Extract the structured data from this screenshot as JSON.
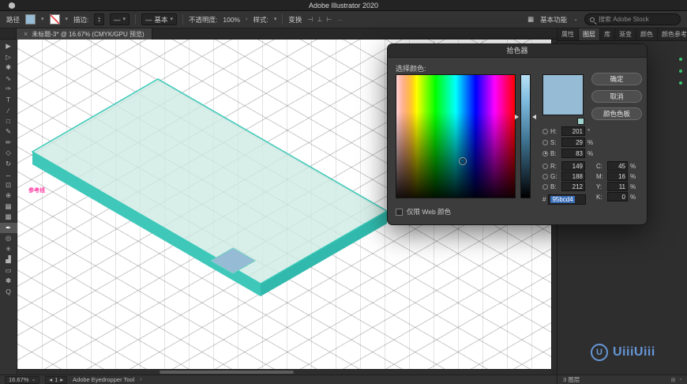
{
  "menubar": {
    "title": "Adobe Illustrator 2020"
  },
  "icons": {
    "caret_down": "▾",
    "caret_small": "⌄",
    "caret_up": "▴",
    "chevron": "›",
    "close": "×",
    "arrow_left": "◂",
    "arrow_right": "▸",
    "dots": "…",
    "line": "—",
    "grid": "▦",
    "panel": "▥",
    "trash": "▫",
    "new": "⊞"
  },
  "control_bar": {
    "selection_label": "路径",
    "stroke_label": "描边:",
    "brush_label": "基本",
    "profile_line": "—",
    "opacity_label": "不透明度:",
    "opacity_value": "100%",
    "style_label": "样式:",
    "transform_label": "变换",
    "workspace_label": "基本功能",
    "search_placeholder": "搜索 Adobe Stock",
    "panel_icons": [
      {
        "name": "align-left-icon",
        "icon": "⊣"
      },
      {
        "name": "align-center-icon",
        "icon": "⊥"
      },
      {
        "name": "align-right-icon",
        "icon": "⊢"
      }
    ]
  },
  "tab_bar": {
    "title": "未标题-3* @ 16.67% (CMYK/GPU 预览)"
  },
  "tools": [
    {
      "name": "selection-tool",
      "icon": "▶"
    },
    {
      "name": "direct-selection-tool",
      "icon": "▷"
    },
    {
      "name": "magic-wand-tool",
      "icon": "✱"
    },
    {
      "name": "lasso-tool",
      "icon": "∿"
    },
    {
      "name": "pen-tool",
      "icon": "✑"
    },
    {
      "name": "type-tool",
      "icon": "T"
    },
    {
      "name": "line-segment-tool",
      "icon": "∕"
    },
    {
      "name": "rectangle-tool",
      "icon": "□"
    },
    {
      "name": "paintbrush-tool",
      "icon": "✎"
    },
    {
      "name": "pencil-tool",
      "icon": "✏"
    },
    {
      "name": "eraser-tool",
      "icon": "◇"
    },
    {
      "name": "rotate-tool",
      "icon": "↻"
    },
    {
      "name": "scale-tool",
      "icon": "↔"
    },
    {
      "name": "free-transform-tool",
      "icon": "⊡"
    },
    {
      "name": "shape-builder-tool",
      "icon": "⊕"
    },
    {
      "name": "mesh-tool",
      "icon": "▦"
    },
    {
      "name": "gradient-tool",
      "icon": "▩"
    },
    {
      "name": "eyedropper-tool",
      "icon": "✒",
      "active": true
    },
    {
      "name": "blend-tool",
      "icon": "◎"
    },
    {
      "name": "symbol-sprayer-tool",
      "icon": "✳"
    },
    {
      "name": "column-graph-tool",
      "icon": "▟"
    },
    {
      "name": "artboard-tool",
      "icon": "▭"
    },
    {
      "name": "hand-tool",
      "icon": "✽"
    },
    {
      "name": "zoom-tool",
      "icon": "Q"
    }
  ],
  "canvas": {
    "guide_label": "参考线"
  },
  "colors": {
    "picked": "#95bcd4",
    "slab_top": "#cdeae3",
    "slab_side": "#3fc8ba",
    "slab_side_dark": "#30b9ac",
    "slab_edge": "#3cc9ba",
    "guide_pink": "#ff3ea5",
    "watermark_blue": "#6a9ce0"
  },
  "dialog": {
    "title": "拾色器",
    "select_label": "选择颜色:",
    "buttons": {
      "ok": "确定",
      "cancel": "取消",
      "swatches": "颜色色板"
    },
    "hsb": [
      {
        "label": "H:",
        "value": "201",
        "unit": "°"
      },
      {
        "label": "S:",
        "value": "29",
        "unit": "%"
      },
      {
        "label": "B:",
        "value": "83",
        "unit": "%"
      }
    ],
    "rgb": [
      {
        "label": "R:",
        "value": "149"
      },
      {
        "label": "G:",
        "value": "188"
      },
      {
        "label": "B:",
        "value": "212"
      }
    ],
    "cmyk": [
      {
        "label": "C:",
        "value": "45",
        "unit": "%"
      },
      {
        "label": "M:",
        "value": "16",
        "unit": "%"
      },
      {
        "label": "Y:",
        "value": "11",
        "unit": "%"
      },
      {
        "label": "K:",
        "value": "0",
        "unit": "%"
      }
    ],
    "hex_prefix": "#",
    "hex": "95bcd4",
    "web_only_label": "仅限 Web 颜色"
  },
  "right_dock": {
    "tabs": [
      {
        "name": "panel-tab-properties",
        "label": "属性"
      },
      {
        "name": "panel-tab-layers",
        "label": "图层",
        "active": true
      },
      {
        "name": "panel-tab-libraries",
        "label": "库"
      },
      {
        "name": "panel-tab-gradient",
        "label": "渐变"
      },
      {
        "name": "panel-tab-color",
        "label": "颜色"
      },
      {
        "name": "panel-tab-color-guide",
        "label": "颜色参考"
      }
    ],
    "footer": "3 图层"
  },
  "status_bar": {
    "zoom": "16.67%",
    "artboard": "1",
    "tool": "Adobe Eyedropper Tool"
  },
  "watermark": {
    "logo_letter": "U",
    "text": "UiiiUiii"
  }
}
